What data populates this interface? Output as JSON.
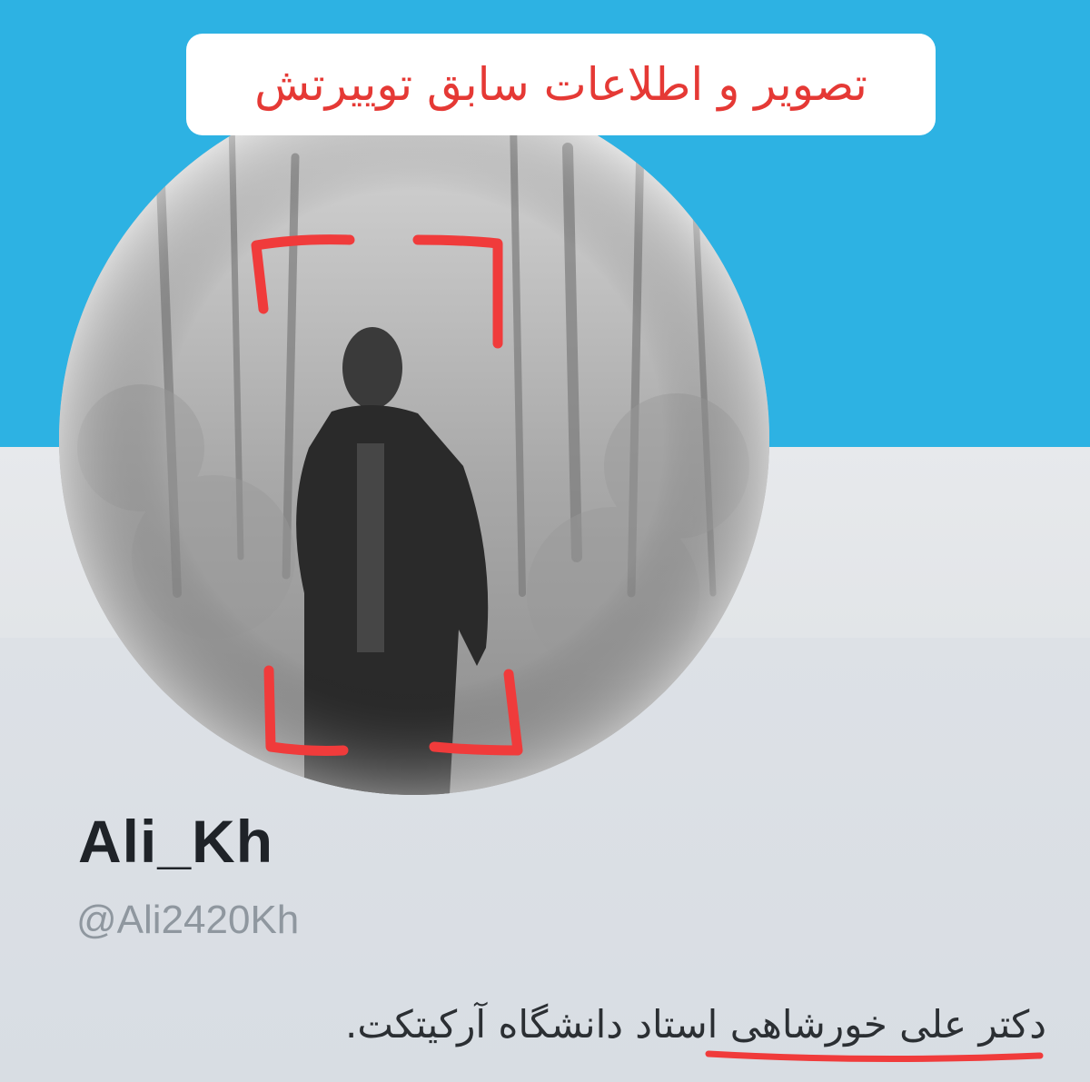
{
  "caption": {
    "text": "تصویر و اطلاعات سابق توییرتش"
  },
  "profile": {
    "display_name": "Ali_Kh",
    "handle": "@Ali2420Kh",
    "bio": "دکتر علی خورشاهی استاد دانشگاه آرکیتکت."
  },
  "colors": {
    "banner": "#2db2e3",
    "annotation_red": "#f03b3b",
    "caption_text": "#e53935"
  },
  "icons": {
    "focus_brackets": "corner-bracket-shapes",
    "underline": "hand-drawn-underline"
  }
}
